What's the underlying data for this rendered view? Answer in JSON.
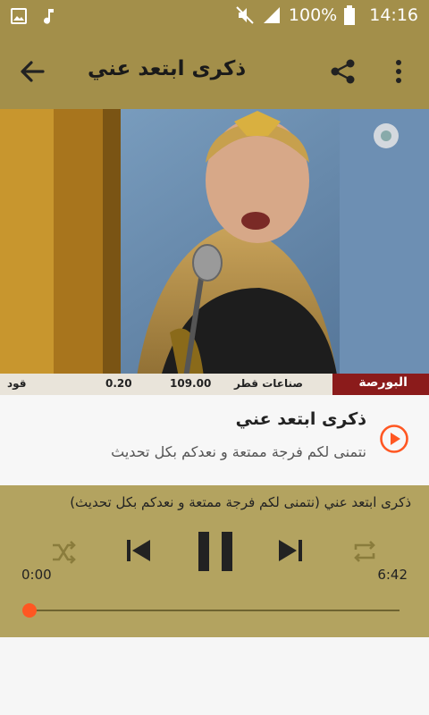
{
  "status": {
    "battery": "100%",
    "time": "14:16"
  },
  "appbar": {
    "title": "ذكرى ابتعد عني"
  },
  "track": {
    "title": "ذكرى ابتعد عني",
    "subtitle": "نتمنى لكم فرجة ممتعة و نعدكم بكل تحديث"
  },
  "player": {
    "now_playing": "ذكرى ابتعد عني (نتمنى لكم فرجة ممتعة و نعدكم بكل تحديث)",
    "elapsed": "0:00",
    "duration": "6:42",
    "progress_fraction": 0
  },
  "video": {
    "ticker": {
      "left_text": "البورصة",
      "items": [
        "صناعات قطر",
        "109.00",
        "0.20",
        "قود"
      ]
    }
  },
  "colors": {
    "bar": "#a38f4a",
    "player_bg": "#b3a360",
    "accent": "#ff5722"
  },
  "icons": [
    "image-icon",
    "music-note-icon",
    "mute-icon",
    "signal-icon",
    "battery-icon",
    "back-arrow-icon",
    "share-icon",
    "more-vert-icon",
    "play-circle-icon",
    "shuffle-icon",
    "previous-icon",
    "pause-icon",
    "next-icon",
    "repeat-icon"
  ]
}
